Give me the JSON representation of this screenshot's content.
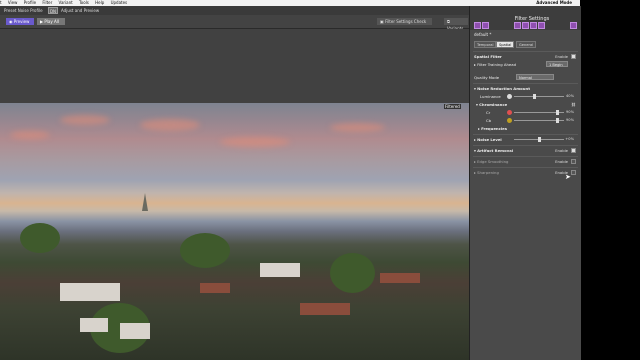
{
  "menu": {
    "items": [
      "t",
      "View",
      "Profile",
      "Filter",
      "Variant",
      "Tools",
      "Help",
      "Updates"
    ],
    "mode": "Advanced Mode"
  },
  "tabs": {
    "tab1": "Preset Noise Profile",
    "tab2": "DN",
    "tab3": "Adjust and Preview"
  },
  "toolbar": {
    "preview": "Preview",
    "play_all": "Play All",
    "filter_settings_check": "Filter Settings Check",
    "variants": "Variants"
  },
  "viewer": {
    "photo_label": "Filtered"
  },
  "panel": {
    "title": "Filter Settings",
    "preset": "default *",
    "subtabs": [
      "Temporal",
      "Spatial",
      "General"
    ],
    "spatial_filter": {
      "label": "Spatial Filter",
      "enable": "Enable"
    },
    "filter_training_ahead": {
      "label": "Filter Training Ahead",
      "value": "1 Begin"
    },
    "quality_mode": {
      "label": "Quality Mode",
      "value": "Normal"
    },
    "noise_reduction_amount": {
      "label": "Noise Reduction Amount",
      "luminance_label": "Luminance",
      "luminance_value": "40%",
      "chrominance_label": "Chrominance",
      "cr_label": "Cr",
      "cr_value": "90%",
      "cb_label": "Cb",
      "cb_value": "90%",
      "frequencies_label": "Frequencies",
      "luminance_fraction": 0.4,
      "cr_fraction": 0.9,
      "cb_fraction": 0.9
    },
    "noise_level": {
      "label": "Noise Level",
      "value": "+0%",
      "fraction": 0.5
    },
    "artifact_removal": {
      "label": "Artifact Removal",
      "enable": "Enable"
    },
    "edge_smoothing": {
      "label": "Edge Smoothing",
      "enable": "Enable"
    },
    "sharpening": {
      "label": "Sharpening",
      "enable": "Enable"
    }
  },
  "colors": {
    "accent": "#6a5acd",
    "panel_bg": "#4a4a4a",
    "icon_purple": "#8f4fb0",
    "cr_dot": "#e05050",
    "cb_dot": "#c0a020"
  }
}
